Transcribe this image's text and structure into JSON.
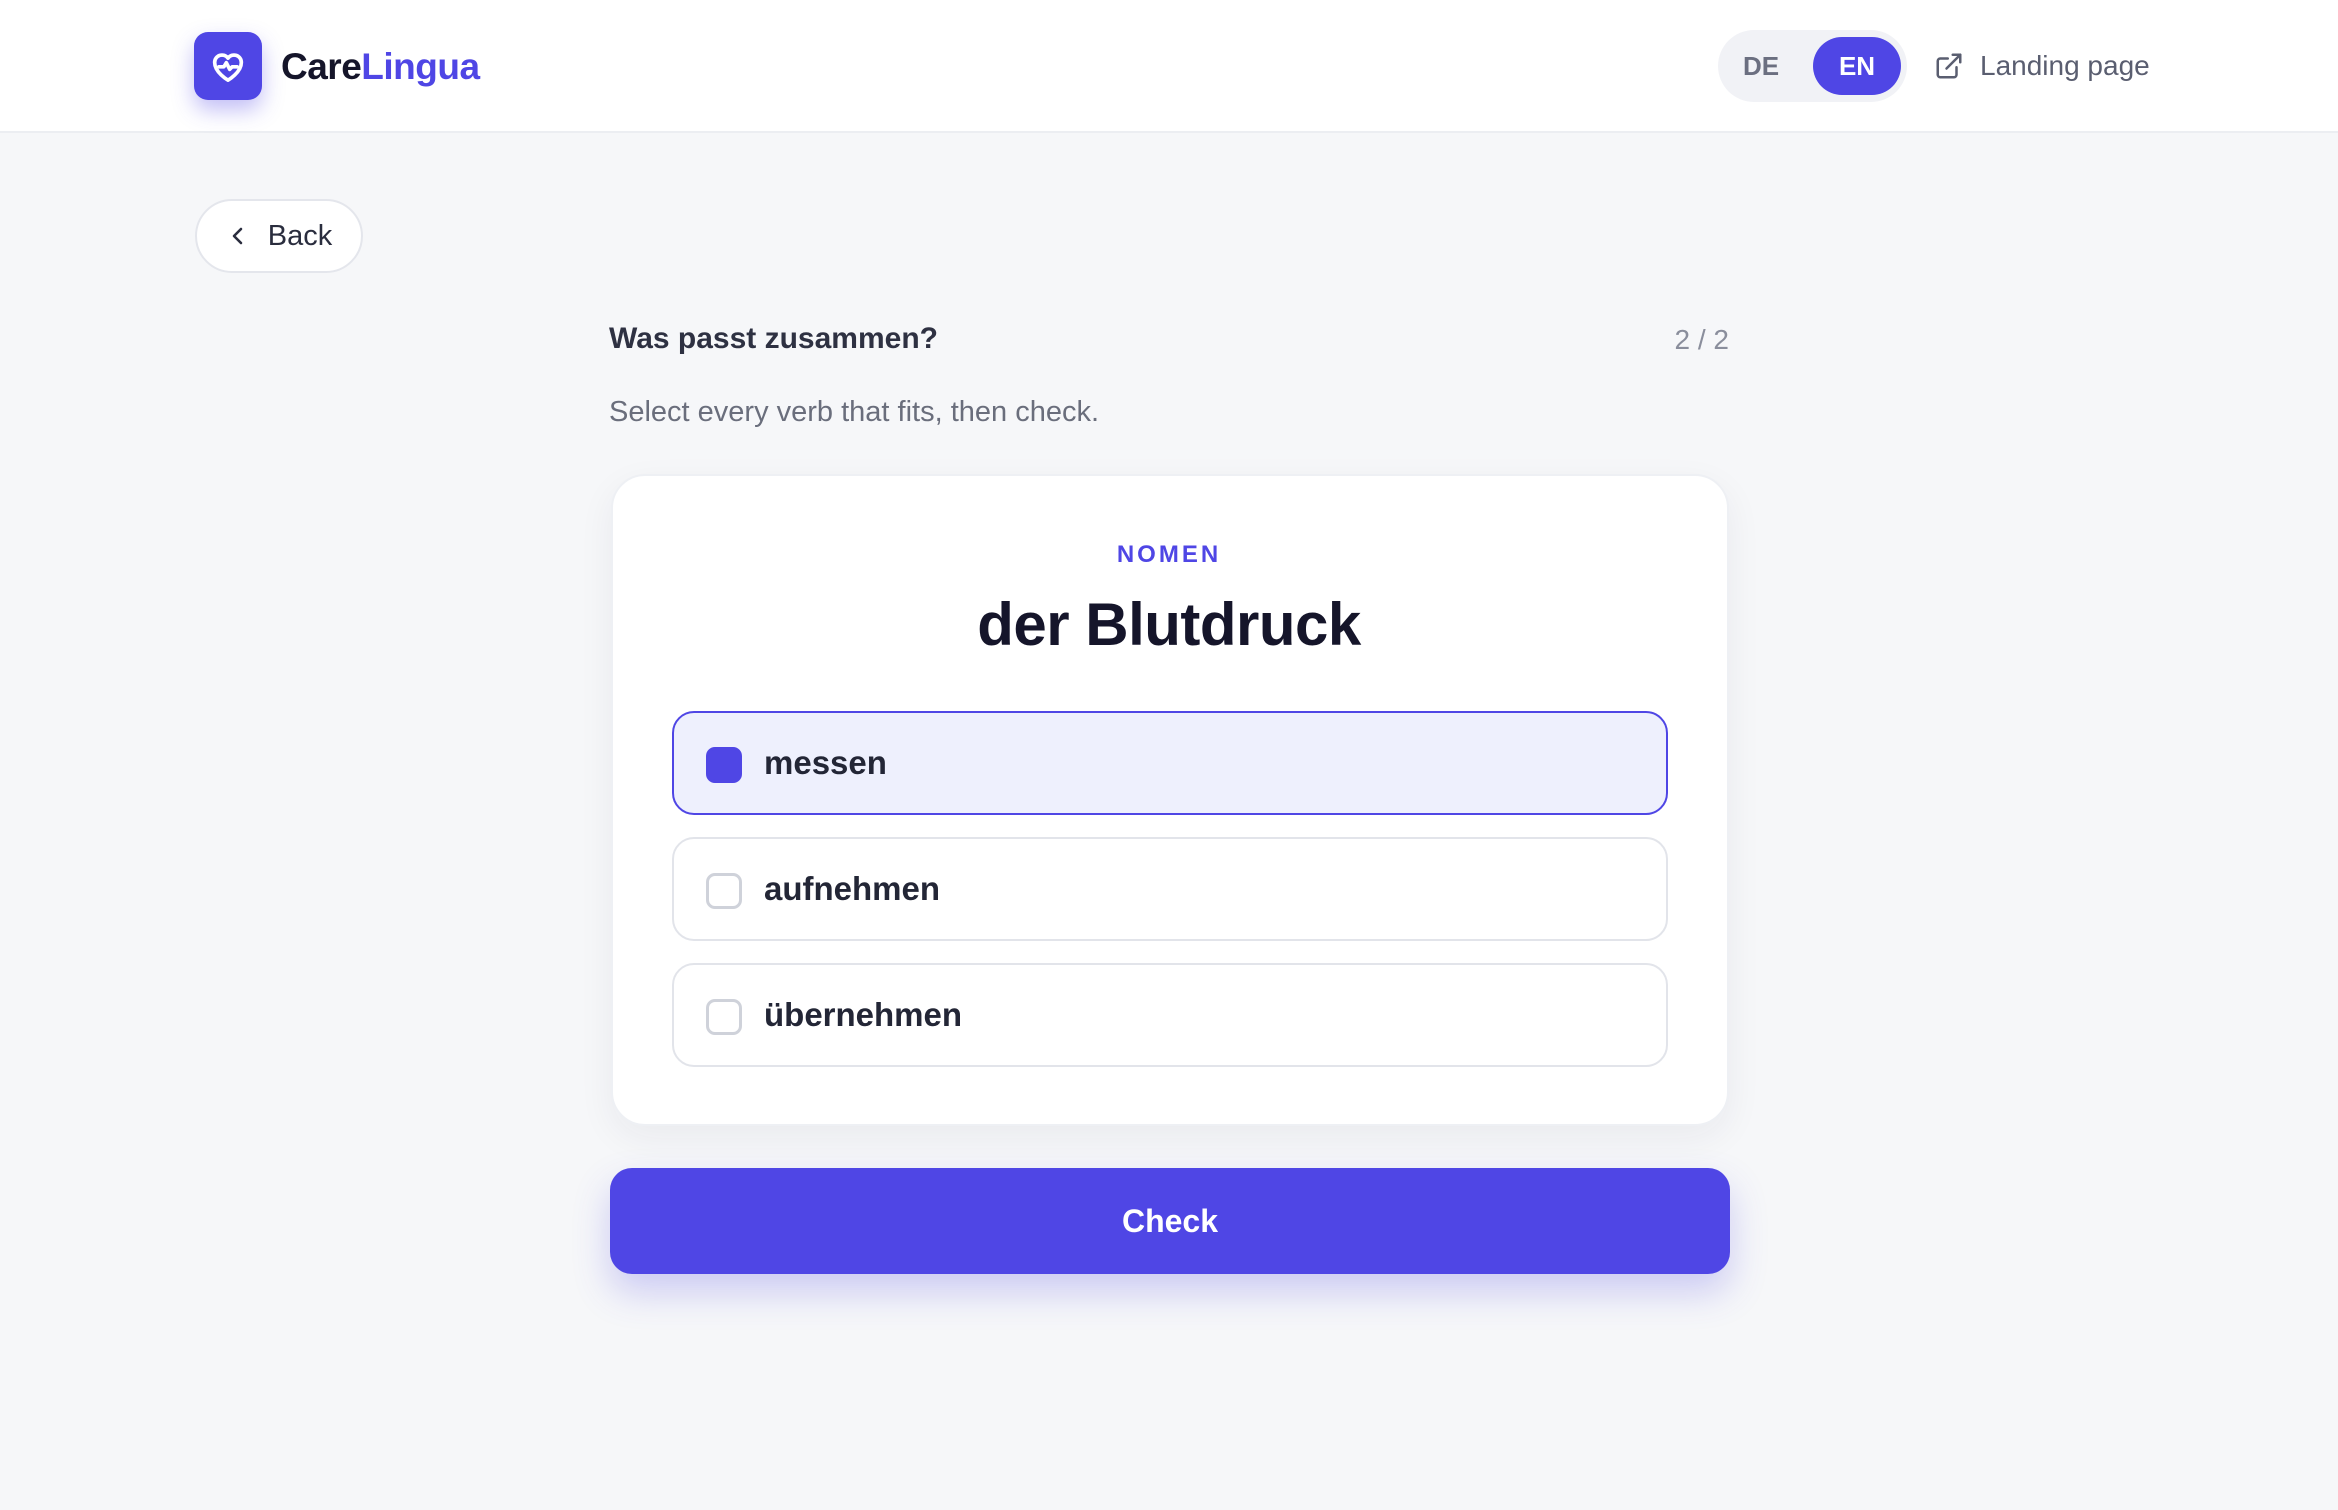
{
  "header": {
    "brand_part1": "Care",
    "brand_part2": "Lingua",
    "logo_icon": "heart-pulse-icon",
    "languages": [
      {
        "label": "DE",
        "active": false
      },
      {
        "label": "EN",
        "active": true
      }
    ],
    "landing_link": "Landing page"
  },
  "nav": {
    "back_label": "Back"
  },
  "exercise": {
    "title": "Was passt zusammen?",
    "progress": "2 / 2",
    "instruction": "Select every verb that fits, then check.",
    "kicker": "NOMEN",
    "word": "der Blutdruck",
    "options": [
      {
        "label": "messen",
        "selected": true
      },
      {
        "label": "aufnehmen",
        "selected": false
      },
      {
        "label": "übernehmen",
        "selected": false
      }
    ],
    "check_label": "Check"
  },
  "colors": {
    "accent": "#4f46e5",
    "selected_bg": "#eef0fd",
    "page_bg": "#f6f7f9"
  }
}
